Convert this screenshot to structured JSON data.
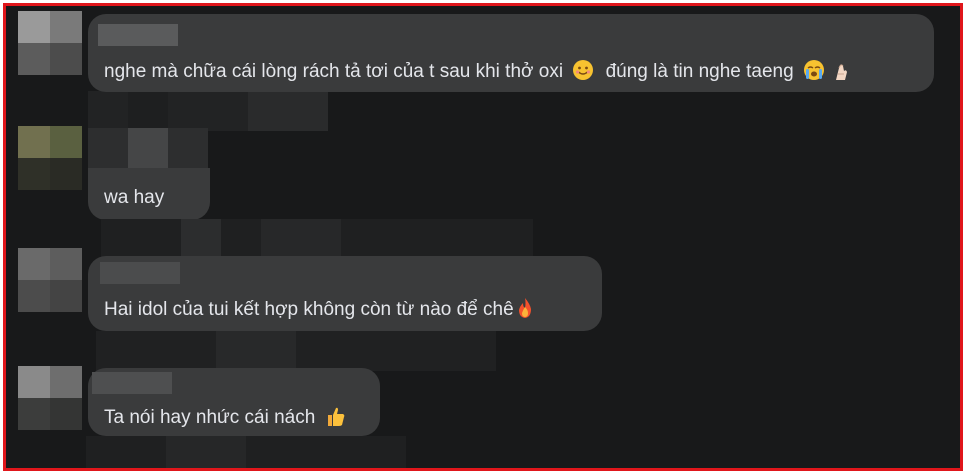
{
  "comments": [
    {
      "text": "nghe mà chữa cái lòng rách tả tơi của t sau khi thở oxi",
      "emoji_mid": "smiling-face-icon",
      "text_after": "đúng là tin nghe taeng",
      "emoji_end": [
        "crying-face-icon",
        "pinched-fingers-icon"
      ]
    },
    {
      "text": "wa hay"
    },
    {
      "text": "Hai idol của tui kết hợp không còn từ nào để chê",
      "emoji_end": [
        "fire-icon"
      ]
    },
    {
      "text": "Ta nói hay nhức cái nách",
      "emoji_end": [
        "thumbs-up-icon"
      ]
    }
  ],
  "colors": {
    "border": "#e0161b",
    "background": "#18191a",
    "bubble": "#3a3b3c",
    "text": "#e4e6eb"
  }
}
